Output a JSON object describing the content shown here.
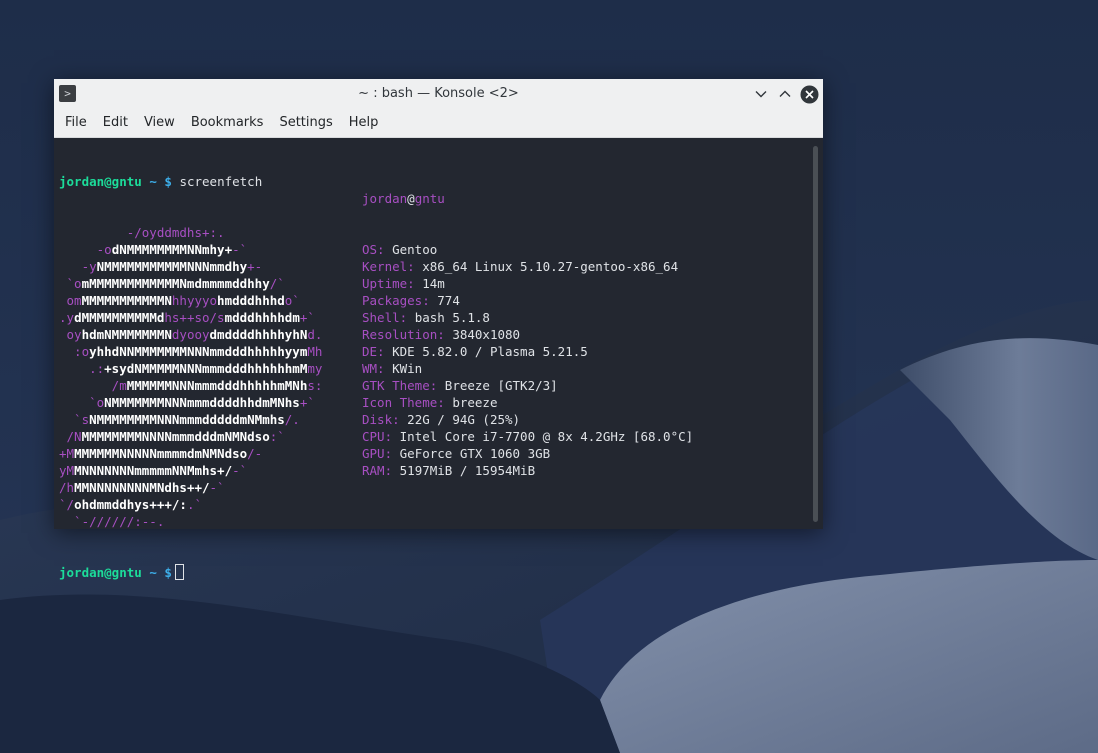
{
  "window": {
    "title": "~ : bash — Konsole <2>",
    "icon": "terminal-icon"
  },
  "menu": [
    "File",
    "Edit",
    "View",
    "Bookmarks",
    "Settings",
    "Help"
  ],
  "prompt": {
    "user_host": "jordan@gntu",
    "path": "~",
    "symbol": "$",
    "command": "screenfetch"
  },
  "logo": [
    [
      [
        "p",
        "         -/oyddmdhs+:."
      ]
    ],
    [
      [
        "p",
        "     -o"
      ],
      [
        "w",
        "dNMMMMMMMMNNmhy+"
      ],
      [
        "p",
        "-`"
      ]
    ],
    [
      [
        "p",
        "   -y"
      ],
      [
        "w",
        "NMMMMMMMMMMMNNNmmdhy"
      ],
      [
        "p",
        "+-"
      ]
    ],
    [
      [
        "p",
        " `o"
      ],
      [
        "w",
        "mMMMMMMMMMMMMNmdmmmmddhhy"
      ],
      [
        "p",
        "/`"
      ]
    ],
    [
      [
        "p",
        " om"
      ],
      [
        "w",
        "MMMMMMMMMMMN"
      ],
      [
        "p",
        "hhyyyo"
      ],
      [
        "w",
        "hmdddhhhd"
      ],
      [
        "p",
        "o`"
      ]
    ],
    [
      [
        "p",
        ".y"
      ],
      [
        "w",
        "dMMMMMMMMMMd"
      ],
      [
        "p",
        "hs++so/s"
      ],
      [
        "w",
        "mdddhhhhdm"
      ],
      [
        "p",
        "+`"
      ]
    ],
    [
      [
        "p",
        " oy"
      ],
      [
        "w",
        "hdmNMMMMMMMN"
      ],
      [
        "p",
        "dyooy"
      ],
      [
        "w",
        "dmddddhhhhyhN"
      ],
      [
        "p",
        "d."
      ]
    ],
    [
      [
        "p",
        "  :o"
      ],
      [
        "w",
        "yhhdNNMMMMMMMNNNmmdddhhhhhyym"
      ],
      [
        "p",
        "Mh"
      ]
    ],
    [
      [
        "p",
        "    .:"
      ],
      [
        "w",
        "+sydNMMMMMNNNmmmdddhhhhhhmM"
      ],
      [
        "p",
        "my"
      ]
    ],
    [
      [
        "p",
        "       /m"
      ],
      [
        "w",
        "MMMMMMNNNmmmdddhhhhhmMNh"
      ],
      [
        "p",
        "s:"
      ]
    ],
    [
      [
        "p",
        "    `o"
      ],
      [
        "w",
        "NMMMMMMMNNNmmmddddhhdmMNhs"
      ],
      [
        "p",
        "+`"
      ]
    ],
    [
      [
        "p",
        "  `s"
      ],
      [
        "w",
        "NMMMMMMMMNNNmmmdddddmNMmhs"
      ],
      [
        "p",
        "/."
      ]
    ],
    [
      [
        "p",
        " /N"
      ],
      [
        "w",
        "MMMMMMMMNNNNmmmdddmNMNdso"
      ],
      [
        "p",
        ":`"
      ]
    ],
    [
      [
        "p",
        "+M"
      ],
      [
        "w",
        "MMMMMMNNNNNmmmmdmNMNdso"
      ],
      [
        "p",
        "/-"
      ]
    ],
    [
      [
        "p",
        "yM"
      ],
      [
        "w",
        "MNNNNNNNmmmmmNNMmhs+/"
      ],
      [
        "p",
        "-`"
      ]
    ],
    [
      [
        "p",
        "/h"
      ],
      [
        "w",
        "MMNNNNNNNNMNdhs++/"
      ],
      [
        "p",
        "-`"
      ]
    ],
    [
      [
        "p",
        "`/"
      ],
      [
        "w",
        "ohdmmddhys+++/:"
      ],
      [
        "p",
        ".`"
      ]
    ],
    [
      [
        "p",
        "  `-//////:--."
      ]
    ]
  ],
  "info_header": {
    "user": "jordan",
    "at": "@",
    "host": "gntu"
  },
  "info": [
    {
      "key": "OS:",
      "value": "Gentoo"
    },
    {
      "key": "Kernel:",
      "value": "x86_64 Linux 5.10.27-gentoo-x86_64"
    },
    {
      "key": "Uptime:",
      "value": "14m"
    },
    {
      "key": "Packages:",
      "value": "774"
    },
    {
      "key": "Shell:",
      "value": "bash 5.1.8"
    },
    {
      "key": "Resolution:",
      "value": "3840x1080"
    },
    {
      "key": "DE:",
      "value": "KDE 5.82.0 / Plasma 5.21.5"
    },
    {
      "key": "WM:",
      "value": "KWin"
    },
    {
      "key": "GTK Theme:",
      "value": "Breeze [GTK2/3]"
    },
    {
      "key": "Icon Theme:",
      "value": "breeze"
    },
    {
      "key": "Disk:",
      "value": "22G / 94G (25%)"
    },
    {
      "key": "CPU:",
      "value": "Intel Core i7-7700 @ 8x 4.2GHz [68.0°C]"
    },
    {
      "key": "GPU:",
      "value": "GeForce GTX 1060 3GB"
    },
    {
      "key": "RAM:",
      "value": "5197MiB / 15954MiB"
    }
  ],
  "colors": {
    "prompt_user": "#1cdc9a",
    "prompt_path": "#3daee9",
    "logo_accent": "#a74fc2",
    "terminal_bg": "#232830"
  }
}
